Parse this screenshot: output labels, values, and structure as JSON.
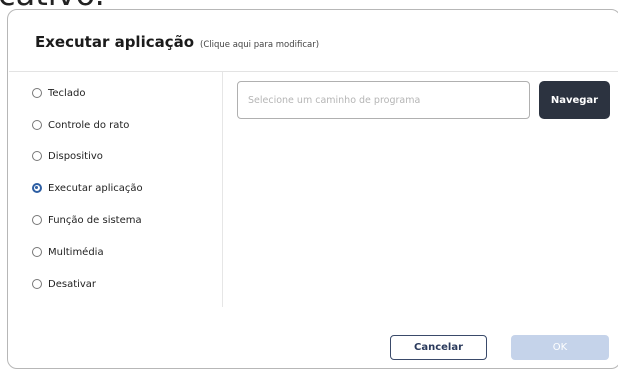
{
  "background": {
    "partial_text": "cativo."
  },
  "dialog": {
    "title": "Executar aplicação",
    "hint": "(Clique aqui para modificar)",
    "options": [
      {
        "label": "Teclado",
        "checked": false
      },
      {
        "label": "Controle do rato",
        "checked": false
      },
      {
        "label": "Dispositivo",
        "checked": false
      },
      {
        "label": "Executar aplicação",
        "checked": true
      },
      {
        "label": "Função de sistema",
        "checked": false
      },
      {
        "label": "Multimédia",
        "checked": false
      },
      {
        "label": "Desativar",
        "checked": false
      }
    ],
    "path": {
      "value": "",
      "placeholder": "Selecione um caminho de programa"
    },
    "browse_label": "Navegar",
    "cancel_label": "Cancelar",
    "ok_label": "OK"
  },
  "colors": {
    "accent": "#2d5ea3",
    "browse_button": "#2c3340",
    "ok_button_disabled": "#c5d3ea"
  }
}
